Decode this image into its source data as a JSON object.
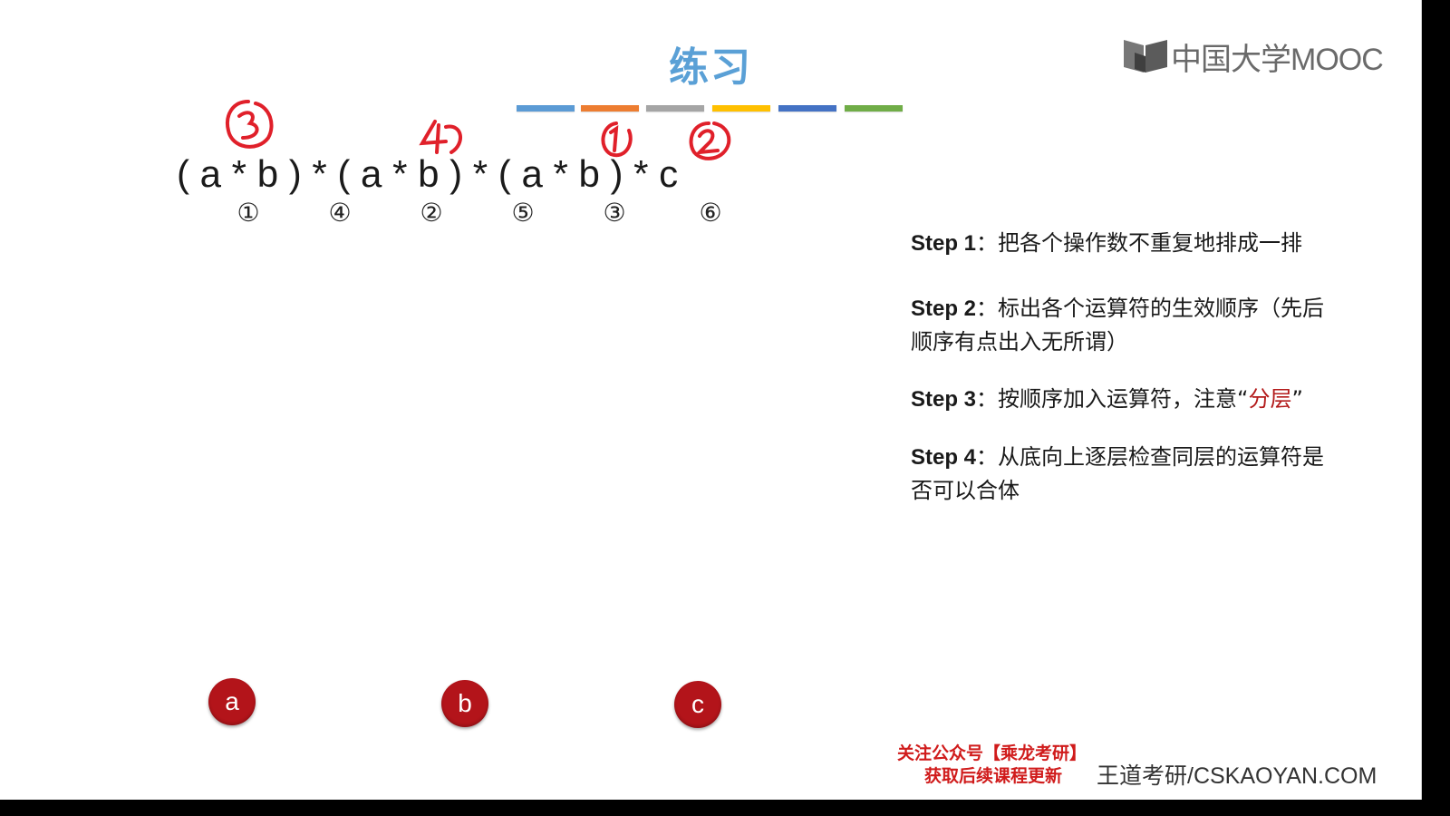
{
  "title": "练习",
  "logo": {
    "text": "中国大学MOOC",
    "icon": "mooc-book-icon"
  },
  "color_bars": [
    "#5b9bd5",
    "#ed7d31",
    "#a5a5a5",
    "#ffc000",
    "#4472c4",
    "#70ad47"
  ],
  "expression": "( a * b ) * ( a * b ) * ( a * b ) * c",
  "operator_order": [
    "①",
    "④",
    "②",
    "⑤",
    "③",
    "⑥"
  ],
  "handwritten_annotations": [
    "3",
    "4",
    "1",
    "2"
  ],
  "steps": [
    {
      "label": "Step 1",
      "text": "：把各个操作数不重复地排成一排"
    },
    {
      "label": "Step 2",
      "text": "：标出各个运算符的生效顺序（先后顺序有点出入无所谓）"
    },
    {
      "label": "Step 3",
      "text_before": "：按顺序加入运算符，注意“",
      "highlight": "分层",
      "text_after": "”"
    },
    {
      "label": "Step 4",
      "text": "：从底向上逐层检查同层的运算符是否可以合体"
    }
  ],
  "nodes": [
    "a",
    "b",
    "c"
  ],
  "promo": {
    "line1": "关注公众号【乘龙考研】",
    "line2": "获取后续课程更新"
  },
  "watermark": "王道考研/CSKAOYAN.COM",
  "colors": {
    "node_fill": "#b3141a",
    "annotation_red": "#e0202a",
    "title_blue": "#5aa0d6",
    "highlight": "#b31a1a"
  }
}
